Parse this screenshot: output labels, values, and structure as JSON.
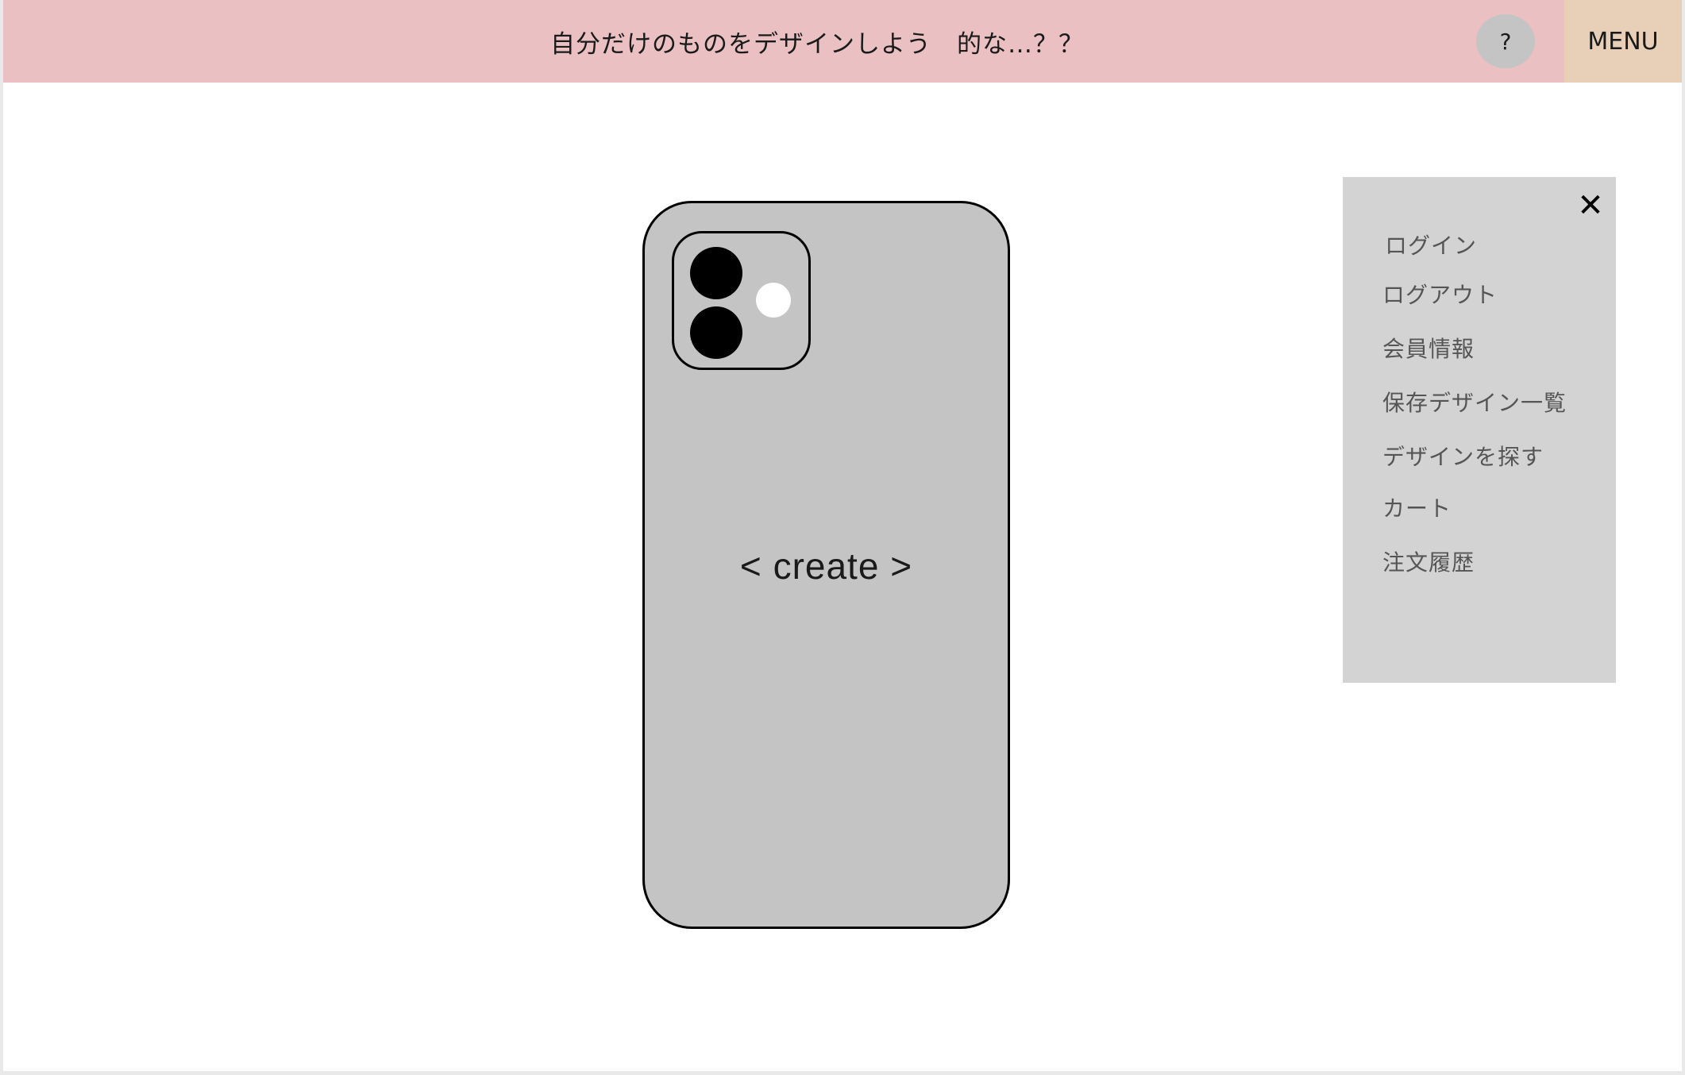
{
  "header": {
    "title": "自分だけのものをデザインしよう　的な…？？",
    "help_label": "?",
    "menu_label": "MENU"
  },
  "main": {
    "phone": {
      "create_label": "< create >"
    }
  },
  "menu_panel": {
    "close_icon": "close-icon",
    "close_glyph": "✕",
    "items": [
      {
        "label": "ログイン"
      },
      {
        "label": "ログアウト"
      },
      {
        "label": "会員情報"
      },
      {
        "label": "保存デザイン一覧"
      },
      {
        "label": "デザインを探す"
      },
      {
        "label": "カート"
      },
      {
        "label": "注文履歴"
      }
    ]
  },
  "colors": {
    "header_bg": "#eac0c2",
    "menu_button_bg": "#e7cfb8",
    "help_button_bg": "#c4c4c4",
    "phone_bg": "#c4c4c4",
    "menu_panel_bg": "#d3d3d3",
    "menu_item_text": "#555555"
  }
}
